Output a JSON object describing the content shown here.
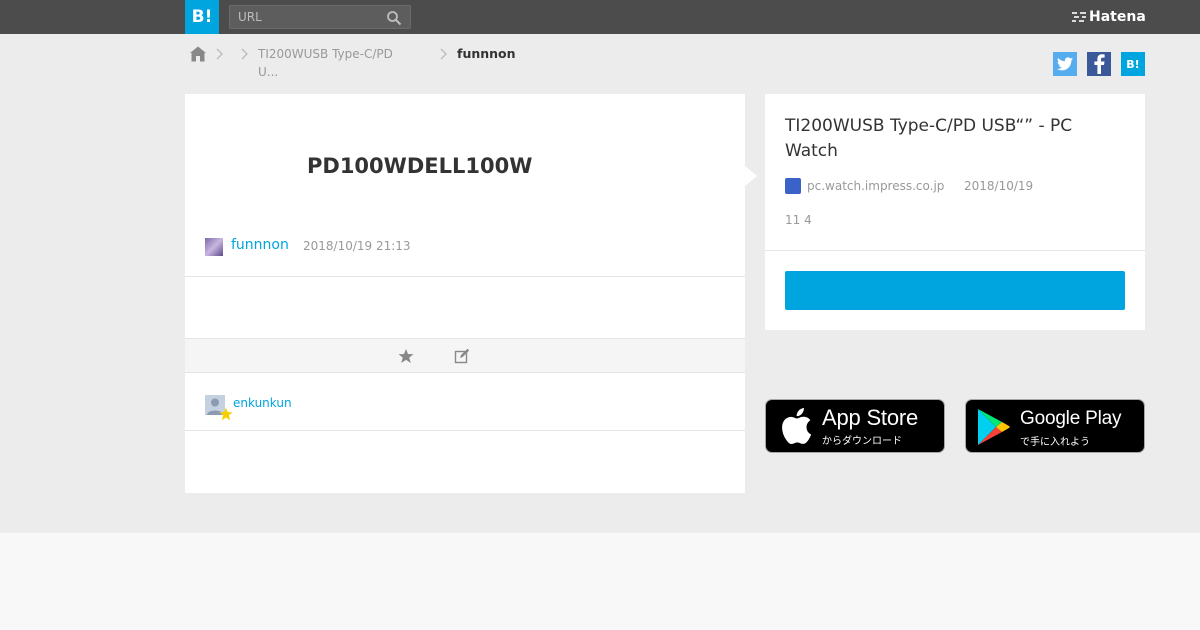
{
  "header": {
    "logo_text": "B!",
    "search_placeholder": "URL",
    "brand": "Hatena"
  },
  "breadcrumb": {
    "entry": "TI200WUSB Type-C/PD U...",
    "user": "funnnon"
  },
  "share": {
    "hatena_label": "B!"
  },
  "comment": {
    "text": "PD100WDELL100W",
    "user": "funnnon",
    "datetime": "2018/10/19 21:13"
  },
  "stars": {
    "user": "enkunkun"
  },
  "entry": {
    "title": "TI200WUSB Type-C/PD USB“” - PC Watch",
    "domain": "pc.watch.impress.co.jp",
    "date": "2018/10/19",
    "counts": "11 4",
    "bookmark_button": ""
  },
  "apps": {
    "app_store_main": "App Store",
    "app_store_sub": "からダウンロード",
    "google_play_main": "Google Play",
    "google_play_sub": "で手に入れよう"
  },
  "colors": {
    "accent": "#00a4de",
    "topbar": "#4c4c4c",
    "twitter": "#55acee",
    "facebook": "#3b5998"
  }
}
